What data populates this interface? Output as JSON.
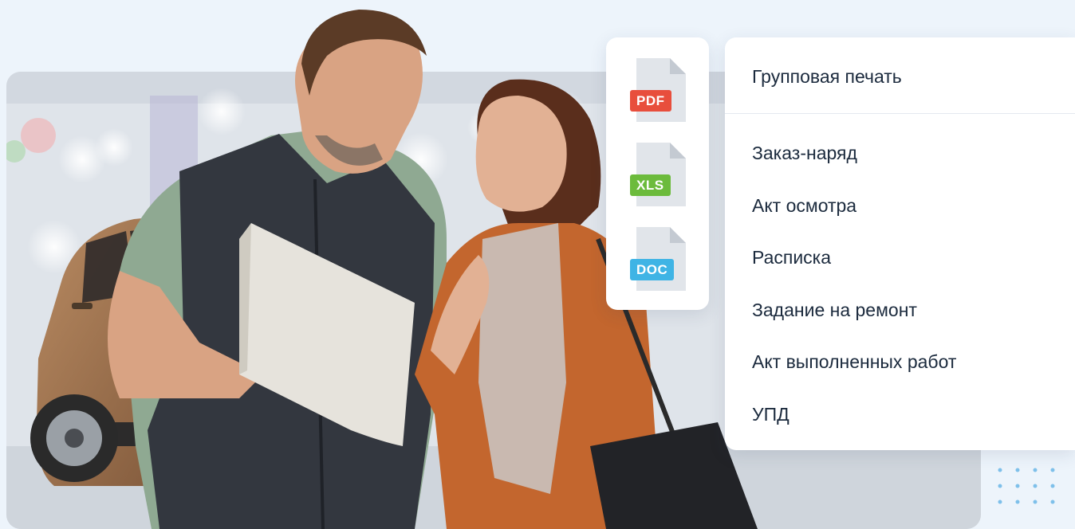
{
  "colors": {
    "background": "#edf4fb",
    "pdf": "#e84e3c",
    "xls": "#6cbb3c",
    "doc": "#3fb4e5",
    "text": "#1b2a3d",
    "dots": "#7ec0ea"
  },
  "formats": [
    {
      "label": "PDF",
      "icon": "pdf-file-icon"
    },
    {
      "label": "XLS",
      "icon": "xls-file-icon"
    },
    {
      "label": "DOC",
      "icon": "doc-file-icon"
    }
  ],
  "menu": {
    "header": "Групповая печать",
    "items": [
      "Заказ-наряд",
      "Акт осмотра",
      "Расписка",
      "Задание на ремонт",
      "Акт выполненных работ",
      "УПД"
    ]
  }
}
